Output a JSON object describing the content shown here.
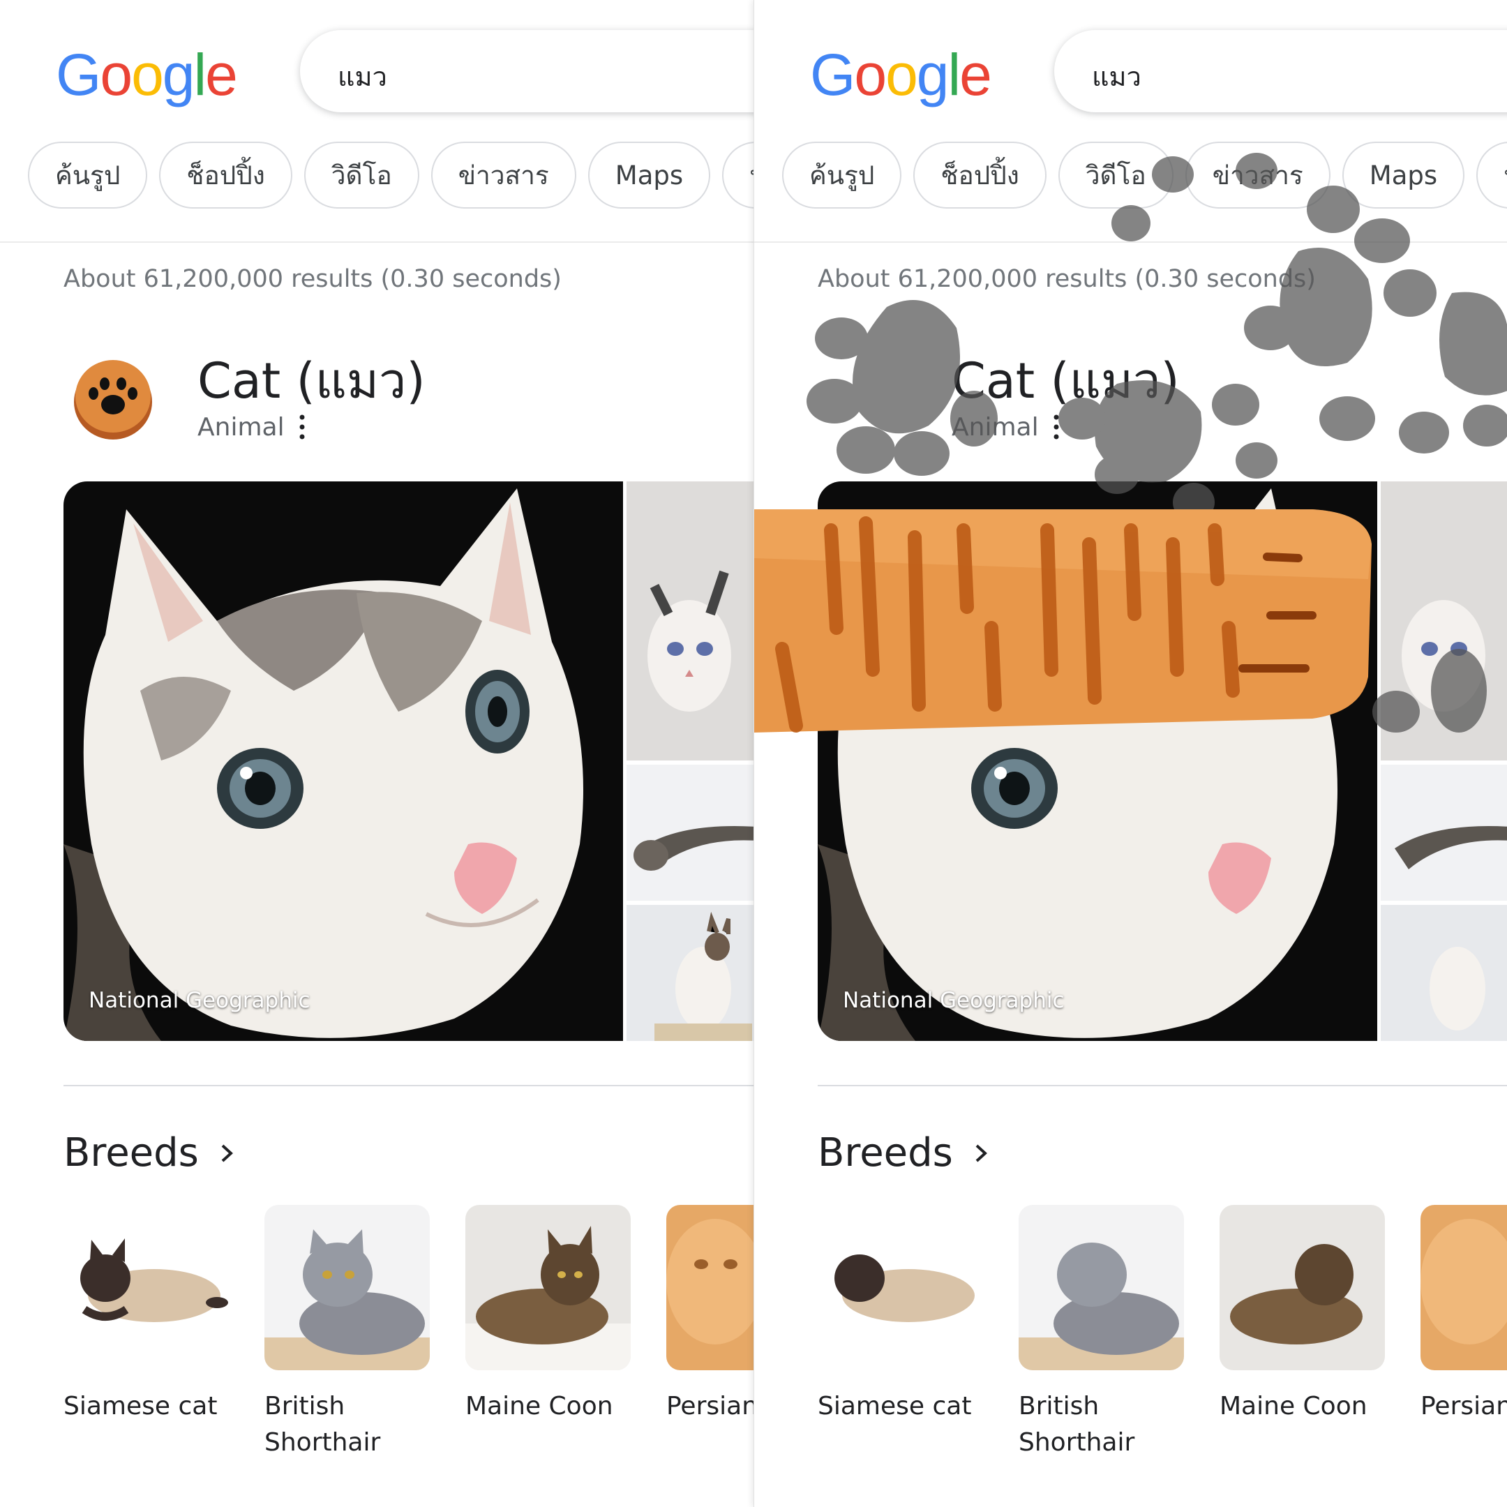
{
  "panels": [
    {
      "id": "left",
      "search": {
        "query": "แมว"
      },
      "chips": [
        "ค้นรูป",
        "ช็อปปิ้ง",
        "วิดีโอ",
        "ข่าวสาร",
        "Maps",
        "น่า รู้"
      ],
      "results_text": "About 61,200,000 results (0.30 seconds)",
      "knowledge_panel": {
        "title": "Cat (แมว)",
        "subtitle": "Animal",
        "image_caption": "National Geographic"
      },
      "breeds": {
        "title": "Breeds",
        "items": [
          "Siamese cat",
          "British Shorthair",
          "Maine Coon",
          "Persian"
        ]
      }
    },
    {
      "id": "right",
      "search": {
        "query": "แมว"
      },
      "chips": [
        "ค้นรูป",
        "ช็อปปิ้ง",
        "วิดีโอ",
        "ข่าวสาร",
        "Maps",
        "น่า"
      ],
      "results_text": "About 61,200,000 results (0.30 seconds)",
      "knowledge_panel": {
        "title": "Cat (แมว)",
        "subtitle": "Animal",
        "image_caption": "National Geographic"
      },
      "breeds": {
        "title": "Breeds",
        "items": [
          "Siamese cat",
          "British Shorthair",
          "Maine Coon",
          "Persian"
        ]
      }
    }
  ],
  "logo": {
    "letters": [
      "G",
      "o",
      "o",
      "g",
      "l",
      "e"
    ],
    "colors": [
      "#4285f4",
      "#ea4335",
      "#fbbc05",
      "#4285f4",
      "#34a853",
      "#ea4335"
    ]
  },
  "icons": [
    "paw-icon",
    "more-vert-icon",
    "chevron-right-icon",
    "cat-paw-overlay",
    "paw-print-overlay"
  ]
}
